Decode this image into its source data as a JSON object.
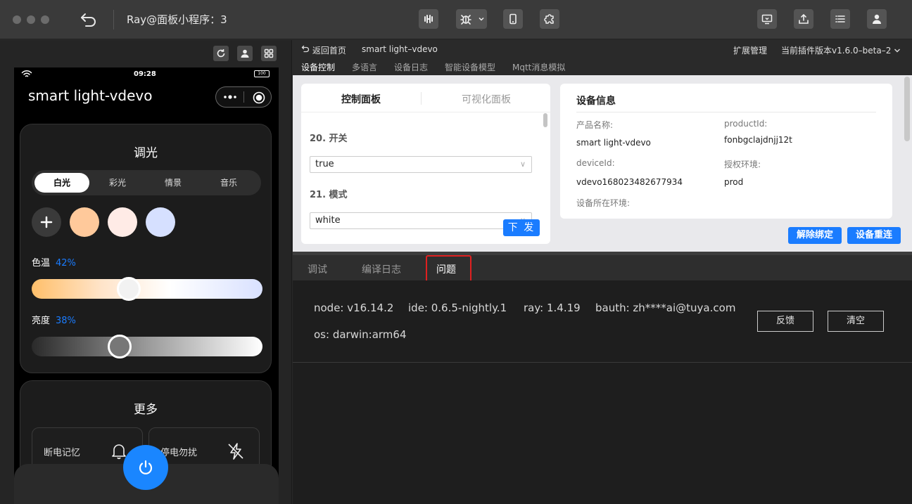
{
  "titlebar": {
    "title": "Ray@面板小程序：3"
  },
  "simulator": {
    "status_time": "09:28",
    "battery": "100",
    "device_name": "smart light-vdevo",
    "dimming": {
      "title": "调光",
      "modes": [
        "白光",
        "彩光",
        "情景",
        "音乐"
      ],
      "active_mode_index": 0,
      "swatch_colors": [
        "#ffc99b",
        "#ffebe6",
        "#d6e0ff"
      ],
      "color_temp": {
        "label": "色温",
        "value": "42%",
        "level": 0.42
      },
      "brightness": {
        "label": "亮度",
        "value": "38%",
        "level": 0.38
      }
    },
    "more": {
      "title": "更多",
      "items": [
        {
          "label": "断电记忆",
          "icon": "bell-icon"
        },
        {
          "label": "停电勿扰",
          "icon": "no-lightning-icon"
        }
      ]
    }
  },
  "topnav": {
    "back_home": "返回首页",
    "device_name": "smart light–vdevo",
    "ext_manage": "扩展管理",
    "plugin_version": "当前插件版本v1.6.0–beta–2"
  },
  "subnav": {
    "tabs": [
      "设备控制",
      "多语言",
      "设备日志",
      "智能设备模型",
      "Mqtt消息模拟"
    ],
    "active_index": 0
  },
  "control_panel": {
    "tabs": [
      "控制面板",
      "可视化面板"
    ],
    "active_index": 0,
    "fields": [
      {
        "label": "20. 开关",
        "value": "true"
      },
      {
        "label": "21. 模式",
        "value": "white"
      }
    ],
    "send_label": "下 发"
  },
  "device_info": {
    "title": "设备信息",
    "product_name_label": "产品名称:",
    "product_name": "smart light-vdevo",
    "product_id_label": "productId:",
    "product_id": "fonbgclajdnjj12t",
    "device_id_label": "deviceId:",
    "device_id": "vdevo168023482677934",
    "auth_env_label": "授权环境:",
    "auth_env": "prod",
    "device_env_label": "设备所在环境:",
    "unbind_label": "解除绑定",
    "reconnect_label": "设备重连"
  },
  "console": {
    "tabs": [
      "调试",
      "编译日志",
      "问题"
    ],
    "active_index": 2,
    "env": {
      "node": "node: v16.14.2",
      "ide": "ide: 0.6.5-nightly.1",
      "ray": "ray: 1.4.19",
      "bauth": "bauth: zh****ai@tuya.com",
      "os": "os: darwin:arm64"
    },
    "feedback_label": "反馈",
    "clear_label": "清空"
  },
  "colors": {
    "accent": "#1a7cff",
    "highlight": "#e02020"
  }
}
